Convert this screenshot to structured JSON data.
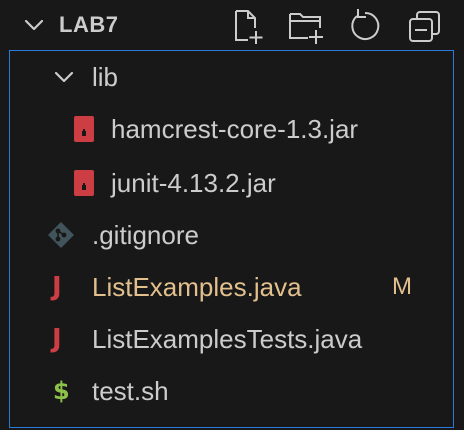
{
  "explorer": {
    "folder_name": "LAB7",
    "actions": [
      {
        "name": "new-file-icon"
      },
      {
        "name": "new-folder-icon"
      },
      {
        "name": "refresh-icon"
      },
      {
        "name": "collapse-all-icon"
      }
    ]
  },
  "tree": {
    "items": [
      {
        "label": "lib",
        "icon": "chevron-down-icon",
        "type": "folder"
      },
      {
        "label": "hamcrest-core-1.3.jar",
        "icon": "jar-file-icon"
      },
      {
        "label": "junit-4.13.2.jar",
        "icon": "jar-file-icon"
      },
      {
        "label": ".gitignore",
        "icon": "git-icon"
      },
      {
        "label": "ListExamples.java",
        "icon": "java-icon",
        "status": "M",
        "modified": true
      },
      {
        "label": "ListExamplesTests.java",
        "icon": "java-icon"
      },
      {
        "label": "test.sh",
        "icon": "shell-icon"
      }
    ]
  },
  "colors": {
    "background": "#181818",
    "text": "#cccccc",
    "modified": "#e2c08d",
    "focus_border": "#2b79d8",
    "java": "#cc3e44",
    "jar": "#cc3e44",
    "shell": "#8dc149"
  }
}
